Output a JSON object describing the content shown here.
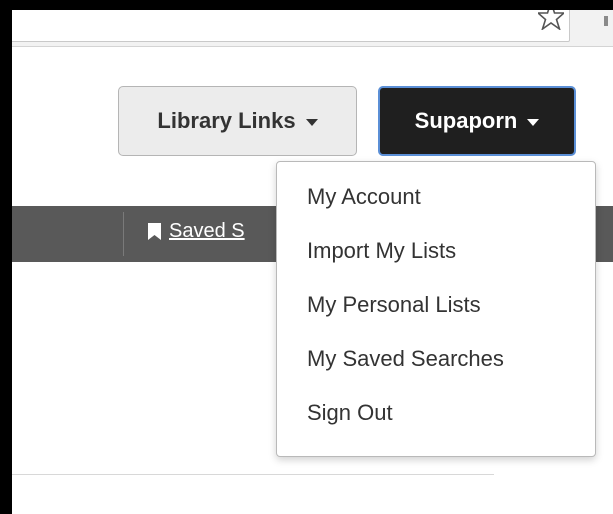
{
  "header": {
    "library_links_label": "Library Links",
    "user_label": "Supaporn"
  },
  "navbar": {
    "saved_searches_label": "Saved S"
  },
  "user_menu": {
    "items": [
      {
        "label": "My Account"
      },
      {
        "label": "Import My Lists"
      },
      {
        "label": "My Personal Lists"
      },
      {
        "label": "My Saved Searches"
      },
      {
        "label": "Sign Out"
      }
    ]
  },
  "colors": {
    "user_button_bg": "#1f1f1f",
    "user_button_border": "#5b8fd6",
    "navbar_bg": "#595959"
  }
}
